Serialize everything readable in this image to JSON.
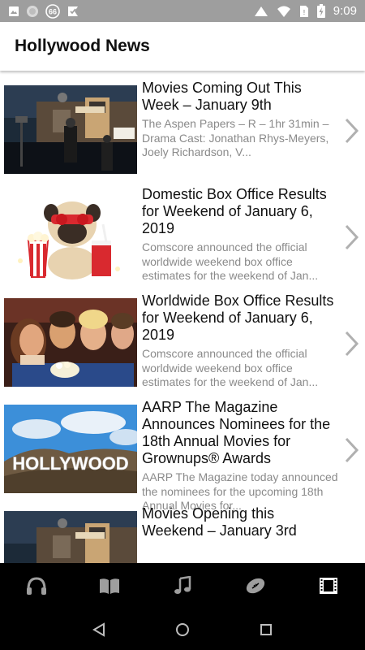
{
  "status_bar": {
    "time": "9:09",
    "notification_badge": "66",
    "icons": [
      "image-icon",
      "circle-icon",
      "speed-badge-icon",
      "check-flag-icon",
      "vibrate-icon",
      "wifi-icon",
      "no-sim-icon",
      "battery-charging-icon"
    ]
  },
  "app_bar": {
    "title": "Hollywood News"
  },
  "articles": [
    {
      "title": "Movies Coming Out This Week – January 9th",
      "snippet": "The Aspen Papers – R – 1hr 31min – Drama Cast: Jonathan Rhys-Meyers, Joely Richardson, V..."
    },
    {
      "title": "Domestic Box Office Results for Weekend of January 6, 2019",
      "snippet": "Comscore announced the official worldwide weekend box office estimates for the weekend of Jan..."
    },
    {
      "title": "Worldwide Box Office Results for Weekend of January 6, 2019",
      "snippet": "Comscore announced the official worldwide weekend box office estimates for the weekend of Jan..."
    },
    {
      "title": "AARP The Magazine Announces Nominees for the 18th Annual Movies for Grownups® Awards",
      "snippet": "AARP The Magazine today announced the nominees for the upcoming 18th Annual Movies for..."
    },
    {
      "title": "Movies Opening this Weekend – January 3rd",
      "snippet": ""
    }
  ],
  "hollywood_sign_text": "HOLLYWOOD",
  "bottom_nav": {
    "items": [
      "headphones-icon",
      "book-icon",
      "music-note-icon",
      "football-icon",
      "film-icon"
    ],
    "active_index": 4
  },
  "system_nav": [
    "back-icon",
    "home-icon",
    "recents-icon"
  ],
  "colors": {
    "status_bar": "#9e9e9e",
    "bottom_nav": "#000000",
    "title_text": "#111111",
    "snippet_text": "#8a8a8a",
    "chevron": "#b0b0b0"
  }
}
